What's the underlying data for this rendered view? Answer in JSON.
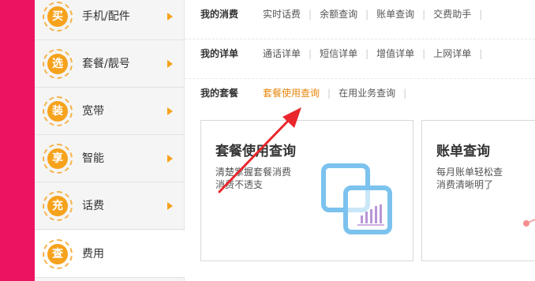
{
  "sidebar": {
    "items": [
      {
        "badge": "买",
        "label": "手机/配件"
      },
      {
        "badge": "选",
        "label": "套餐/靓号"
      },
      {
        "badge": "装",
        "label": "宽带"
      },
      {
        "badge": "享",
        "label": "智能"
      },
      {
        "badge": "充",
        "label": "话费"
      },
      {
        "badge": "查",
        "label": "费用"
      }
    ]
  },
  "menu": {
    "consumption": {
      "title": "我的消费",
      "links": [
        "实时话费",
        "余额查询",
        "账单查询",
        "交费助手"
      ]
    },
    "details": {
      "title": "我的详单",
      "links": [
        "通话详单",
        "短信详单",
        "增值详单",
        "上网详单"
      ]
    },
    "package": {
      "title": "我的套餐",
      "links": [
        "套餐使用查询",
        "在用业务查询"
      ]
    }
  },
  "cards": [
    {
      "title": "套餐使用查询",
      "line1": "清楚掌握套餐消费",
      "line2": "消费不透支"
    },
    {
      "title": "账单查询",
      "line1": "每月账单轻松查",
      "line2": "消费清晰明了"
    }
  ],
  "colors": {
    "brand": "#ec1460",
    "accent": "#f6a21c",
    "link_highlight": "#e8850a",
    "icon_blue": "#7cc2ee",
    "icon_purple": "#b995d8",
    "annotation_red": "#e8262b"
  },
  "icons": {
    "side_arrow": "triangle-right-icon",
    "package_card": "overlapping-squares-chart-icon",
    "bill_card": "share-node-icon"
  }
}
